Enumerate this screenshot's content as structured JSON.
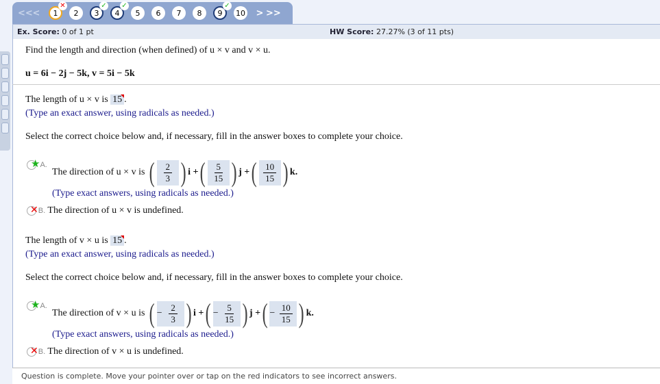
{
  "nav": {
    "first": "<<",
    "prev": "<",
    "next": ">",
    "last": ">>",
    "questions": [
      {
        "n": "1",
        "state": "current",
        "badge": "✕"
      },
      {
        "n": "2",
        "state": "",
        "badge": ""
      },
      {
        "n": "3",
        "state": "done",
        "badge": "✓"
      },
      {
        "n": "4",
        "state": "done",
        "badge": "✓"
      },
      {
        "n": "5",
        "state": "",
        "badge": ""
      },
      {
        "n": "6",
        "state": "",
        "badge": ""
      },
      {
        "n": "7",
        "state": "",
        "badge": ""
      },
      {
        "n": "8",
        "state": "",
        "badge": ""
      },
      {
        "n": "9",
        "state": "done",
        "badge": "✓"
      },
      {
        "n": "10",
        "state": "",
        "badge": ""
      }
    ]
  },
  "score": {
    "ex_label": "Ex. Score:",
    "ex_value": "0 of 1 pt",
    "hw_label": "HW Score:",
    "hw_value": "27.27% (3 of 11 pts)"
  },
  "question": {
    "prompt": "Find the length and direction (when defined) of u × v and v × u.",
    "given": "u = 6i − 2j − 5k,   v = 5i − 5k"
  },
  "part1": {
    "length_prefix": "The length of u × v is",
    "length_answer": "15",
    "hint": "(Type an exact answer, using radicals as needed.)",
    "select": "Select the correct choice below and, if necessary, fill in the answer boxes to complete your choice.",
    "a_label": "A.",
    "a_text": "The direction of u × v is",
    "a_fracs": [
      {
        "sign": "",
        "num": "2",
        "den": "3",
        "unit": "i +"
      },
      {
        "sign": "",
        "num": "5",
        "den": "15",
        "unit": "j +"
      },
      {
        "sign": "",
        "num": "10",
        "den": "15",
        "unit": "k."
      }
    ],
    "a_hint": "(Type exact answers, using radicals as needed.)",
    "b_label": "B.",
    "b_text": "The direction of u × v is undefined."
  },
  "part2": {
    "length_prefix": "The length of v × u is",
    "length_answer": "15",
    "hint": "(Type an exact answer, using radicals as needed.)",
    "select": "Select the correct choice below and, if necessary, fill in the answer boxes to complete your choice.",
    "a_label": "A.",
    "a_text": "The direction of v × u is",
    "a_fracs": [
      {
        "sign": "−",
        "num": "2",
        "den": "3",
        "unit": "i +"
      },
      {
        "sign": "−",
        "num": "5",
        "den": "15",
        "unit": "j +"
      },
      {
        "sign": "−",
        "num": "10",
        "den": "15",
        "unit": "k."
      }
    ],
    "a_hint": "(Type exact answers, using radicals as needed.)",
    "b_label": "B.",
    "b_text": "The direction of v × u is undefined."
  },
  "status": "Question is complete. Move your pointer over or tap on the red indicators to see incorrect answers.",
  "colors": {
    "nav": "#8fa6d0",
    "correct": "#1db31d",
    "incorrect": "#e00000",
    "hint": "#1a1a8c"
  }
}
